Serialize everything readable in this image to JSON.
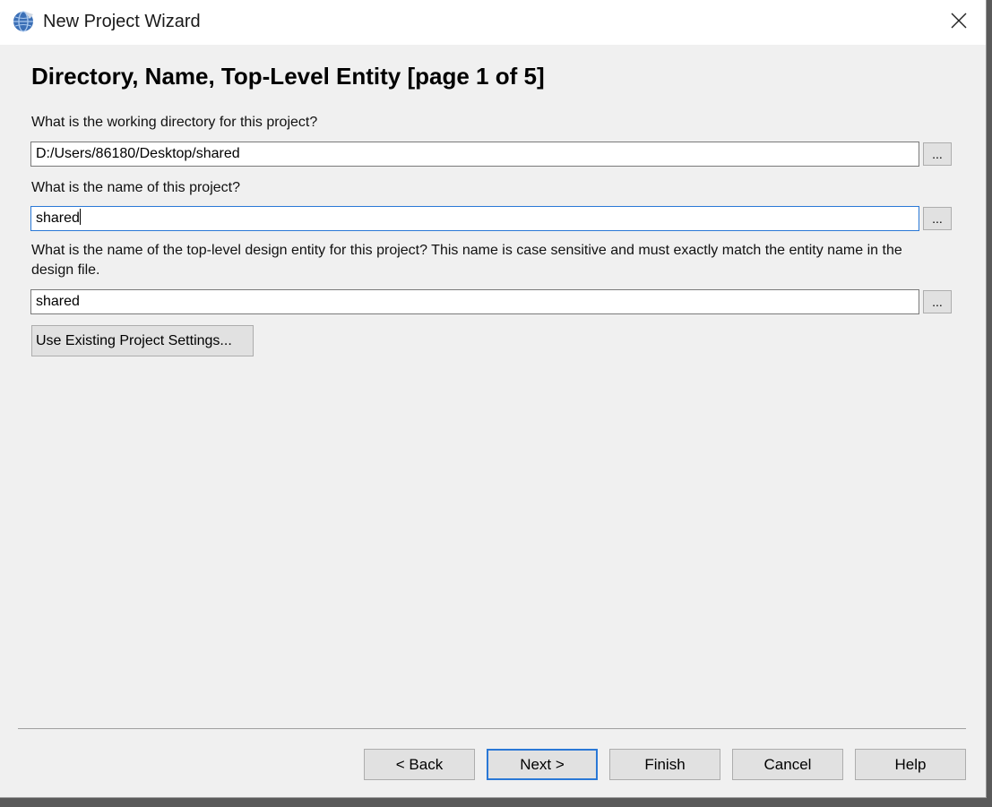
{
  "window": {
    "title": "New Project Wizard"
  },
  "page": {
    "heading": "Directory, Name, Top-Level Entity [page 1 of 5]",
    "working_dir": {
      "label": "What is the working directory for this project?",
      "value": "D:/Users/86180/Desktop/shared",
      "browse_label": "..."
    },
    "project_name": {
      "label": "What is the name of this project?",
      "value": "shared",
      "browse_label": "..."
    },
    "top_entity": {
      "label": "What is the name of the top-level design entity for this project? This name is case sensitive and must exactly match the entity name in the design file.",
      "value": "shared",
      "browse_label": "..."
    },
    "use_existing_label": "Use Existing Project Settings..."
  },
  "footer": {
    "back": "< Back",
    "next": "Next >",
    "finish": "Finish",
    "cancel": "Cancel",
    "help": "Help"
  },
  "colors": {
    "focus_accent": "#2a78d6",
    "dialog_bg": "#f0f0f0"
  },
  "icons": {
    "app": "globe-app-icon",
    "close": "close-icon"
  }
}
